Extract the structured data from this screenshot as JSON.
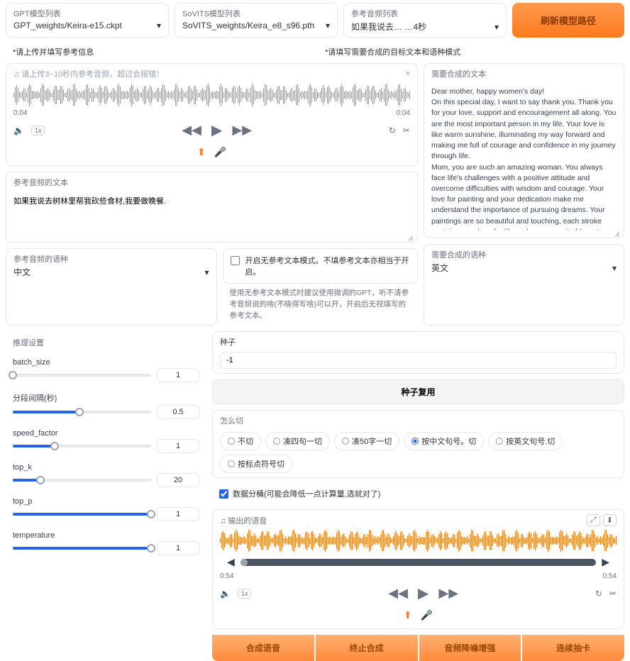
{
  "top": {
    "gpt_label": "GPT模型列表",
    "gpt_value": "GPT_weights/Keira-e15.ckpt",
    "sovits_label": "SoVITS模型列表",
    "sovits_value": "SoVITS_weights/Keira_e8_s96.pth",
    "refaudio_label": "参考音频列表",
    "refaudio_value": "如果我说去… …4秒",
    "refresh": "刷新模型路径"
  },
  "hints": {
    "left": "*请上传并填写参考信息",
    "right": "*请填写需要合成的目标文本和语种模式"
  },
  "ref": {
    "upload_hint": "请上传3~10秒内参考音频，超过会报错！",
    "t0": "0:04",
    "t1": "0:04",
    "speed": "1x",
    "text_label": "参考音频的文本",
    "text_value": "如果我说去树林里帮我砍些食材,我要做晚餐.",
    "lang_label": "参考音频的语种",
    "lang_value": "中文",
    "no_ref_checkbox": "开启无参考文本模式。不填参考文本亦相当于开启。",
    "no_ref_note": "使用无参考文本模式时建议使用微调的GPT，听不清参考音频说的啥(不晓得写啥)可以开，开启后无视填写的参考文本。"
  },
  "target": {
    "text_label": "需要合成的文本",
    "text_value": "Dear mother, happy women's day!\nOn this special day, I want to say thank you. Thank you for your love, support and encouragement all along. You are the most important person in my life. Your love is like warm sunshine, illuminating my way forward and making me full of courage and confidence in my journey through life.\nMom, you are such an amazing woman. You always face life's challenges with a positive attitude and overcome difficulties with wisdom and courage. Your love for painting and your dedication make me understand the importance of pursuing dreams. Your paintings are so beautiful and touching, each stroke contains your love for life and your pursuit of beauty. Your artistic talent makes me feel extremely proud.\nOn this special day, I wish your life was as colorful as your paintings, and your heart would always be filled with artistic inspiration. May you be happy and happy every day, and may all your dreams come true.\nMom, I love you! Again, happy women's day!",
    "lang_label": "需要合成的语种",
    "lang_value": "英文"
  },
  "infer": {
    "title": "推理设置",
    "batch_size": {
      "label": "batch_size",
      "value": "1",
      "fill": 0
    },
    "split": {
      "label": "分段间隔(秒)",
      "value": "0.5",
      "fill": 48
    },
    "speed": {
      "label": "speed_factor",
      "value": "1",
      "fill": 30
    },
    "top_k": {
      "label": "top_k",
      "value": "20",
      "fill": 20
    },
    "top_p": {
      "label": "top_p",
      "value": "1",
      "fill": 100
    },
    "temperature": {
      "label": "temperature",
      "value": "1",
      "fill": 100
    }
  },
  "seed": {
    "label": "种子",
    "value": "-1",
    "reuse_btn": "种子复用",
    "cut_label": "怎么切",
    "opts": [
      "不切",
      "凑四句一切",
      "凑50字一切",
      "按中文句号。切",
      "按英文句号.切",
      "按标点符号切"
    ],
    "selected": 3,
    "bucket_label": "数据分桶(可能会降低一点计算量,选就对了)"
  },
  "output": {
    "label": "输出的语音",
    "t0": "0:54",
    "t1": "0:54",
    "speed": "1x"
  },
  "actions": [
    "合成语音",
    "终止合成",
    "音频降噪增强",
    "连续抽卡"
  ]
}
